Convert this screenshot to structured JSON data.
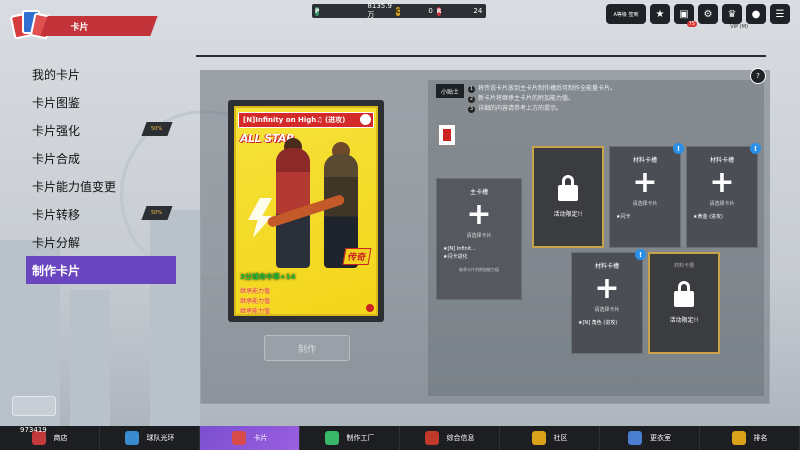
{
  "header": {
    "section_title": "卡片",
    "stats": {
      "p_label": "P",
      "p_value": "8135.9万",
      "c_label": "C",
      "c_value": "0",
      "r_label": "R",
      "r_value": "24"
    },
    "right_icons": [
      "mail-icon",
      "gift-icon",
      "bell-icon",
      "vip-icon",
      "info-icon",
      "menu-icon"
    ],
    "right_pill_text": "A等级 签到",
    "bag_badge": "75",
    "vip_label": "VIP (M)"
  },
  "menu": {
    "items": [
      {
        "label": "我的卡片",
        "pct": ""
      },
      {
        "label": "卡片图鉴",
        "pct": ""
      },
      {
        "label": "卡片强化",
        "pct": "50%"
      },
      {
        "label": "卡片合成",
        "pct": ""
      },
      {
        "label": "卡片能力值变更",
        "pct": ""
      },
      {
        "label": "卡片转移",
        "pct": "50%"
      },
      {
        "label": "卡片分解",
        "pct": ""
      },
      {
        "label": "制作卡片",
        "pct": ""
      }
    ],
    "active_index": 7
  },
  "card": {
    "title": "[N]Infinity on High♫ (进攻)",
    "tag": "ALL STAR",
    "rarity": "传奇",
    "stat_green": "3分球命中率+14",
    "stat_red": [
      "继承能力值",
      "继承能力值",
      "继承能力值"
    ]
  },
  "make_button": "制作",
  "tips": {
    "label": "小贴士",
    "lines": [
      "将传说卡片放到主卡片制作槽后可制作全能量卡片。",
      "新卡片将继承主卡片的附加能力值。",
      "详细的内容请参考上方的提示。"
    ]
  },
  "main_slot": {
    "title": "主卡槽",
    "sub": "请选择卡片",
    "details": [
      "★[N] Infinit...",
      "★闪卡进化"
    ],
    "foot": "继承卡片的附加能力值"
  },
  "material_slots": [
    {
      "title": "材料卡槽",
      "sub": "请选择卡片",
      "detail": "★闪卡"
    },
    {
      "title": "材料卡槽",
      "sub": "请选择卡片",
      "detail": "★黄金 (进攻)"
    },
    {
      "title": "材料卡槽",
      "sub": "请选择卡片",
      "detail": "★[N] 角色 (进攻)"
    }
  ],
  "locked_slots": [
    {
      "title": "",
      "text": "活动限定!!"
    },
    {
      "title": "材料卡槽",
      "text": "活动限定!!"
    }
  ],
  "bottom_nav": [
    {
      "label": "商店",
      "color": "#c23a3a"
    },
    {
      "label": "球队光环",
      "color": "#3a8ad0"
    },
    {
      "label": "卡片",
      "color": "#d84a4a"
    },
    {
      "label": "制作工厂",
      "color": "#3ab86a"
    },
    {
      "label": "综合信息",
      "color": "#c0392b"
    },
    {
      "label": "社区",
      "color": "#d9a21a"
    },
    {
      "label": "更衣室",
      "color": "#4a7fd0"
    },
    {
      "label": "排名",
      "color": "#d9a21a"
    }
  ],
  "bottom_active": 2,
  "user_id": "973419"
}
